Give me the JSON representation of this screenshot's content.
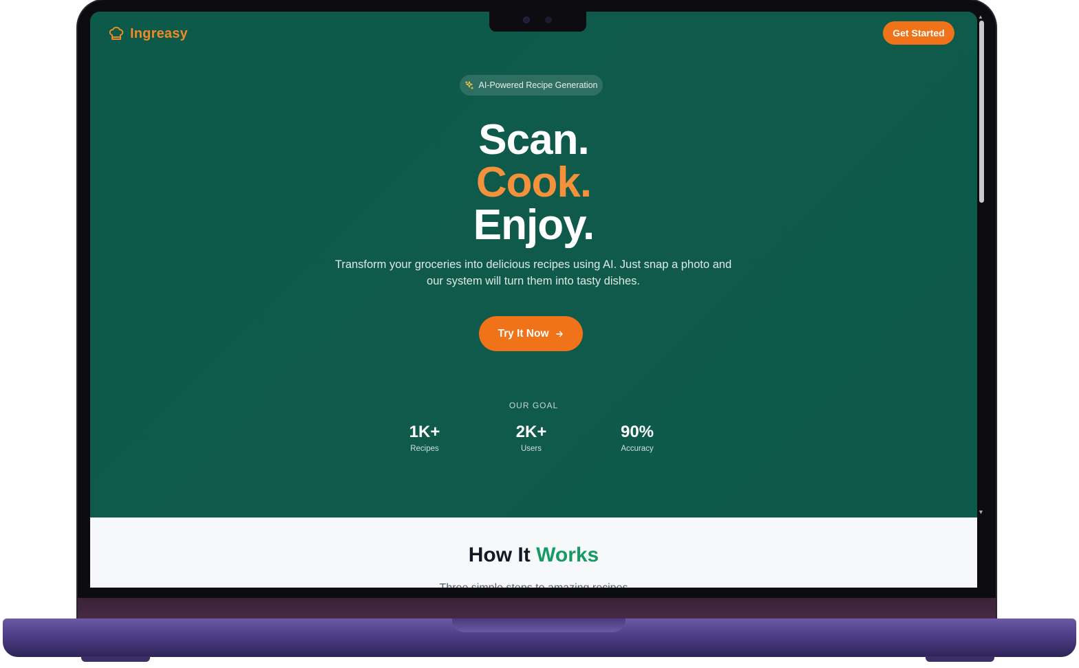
{
  "nav": {
    "brand": "Ingreasy",
    "cta": "Get Started"
  },
  "hero": {
    "badge": "AI-Powered Recipe Generation",
    "line1": "Scan.",
    "line2": "Cook.",
    "line3": "Enjoy.",
    "subtitle": "Transform your groceries into delicious recipes using AI. Just snap a photo and our system will turn them into tasty dishes.",
    "button": "Try It Now"
  },
  "goal": {
    "label": "OUR GOAL",
    "stats": [
      {
        "value": "1K+",
        "label": "Recipes"
      },
      {
        "value": "2K+",
        "label": "Users"
      },
      {
        "value": "90%",
        "label": "Accuracy"
      }
    ]
  },
  "works": {
    "title_a": "How It",
    "title_b": "Works",
    "subtitle": "Three simple steps to amazing recipes"
  },
  "colors": {
    "hero_bg": "#0f5a4b",
    "accent_orange": "#f07219",
    "accent_green": "#169a66"
  },
  "icons": {
    "brand": "chef-hat-icon",
    "badge": "sparkles-icon",
    "button": "arrow-right-icon"
  }
}
